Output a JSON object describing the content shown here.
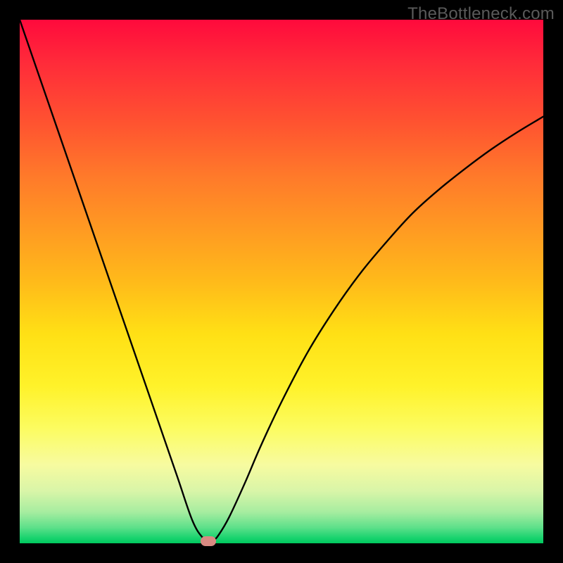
{
  "watermark": "TheBottleneck.com",
  "chart_data": {
    "type": "line",
    "title": "",
    "xlabel": "",
    "ylabel": "",
    "xlim": [
      0,
      100
    ],
    "ylim": [
      0,
      100
    ],
    "grid": false,
    "legend": false,
    "background": "rainbow-vertical-gradient",
    "series": [
      {
        "name": "bottleneck-curve",
        "color": "#000000",
        "x": [
          0,
          5,
          10,
          15,
          20,
          25,
          30,
          33,
          35,
          36,
          37,
          38,
          40,
          43,
          46,
          50,
          55,
          60,
          65,
          70,
          75,
          80,
          85,
          90,
          95,
          100
        ],
        "y": [
          100,
          85.5,
          71,
          56.5,
          42,
          27.5,
          13,
          4.3,
          1.0,
          0.4,
          0.6,
          1.6,
          5.0,
          11.5,
          18.5,
          27.0,
          36.5,
          44.5,
          51.5,
          57.5,
          63.0,
          67.5,
          71.5,
          75.2,
          78.5,
          81.5
        ]
      }
    ],
    "marker": {
      "x": 36,
      "y": 0.4,
      "shape": "rounded-rect",
      "color": "#d98a82"
    }
  }
}
